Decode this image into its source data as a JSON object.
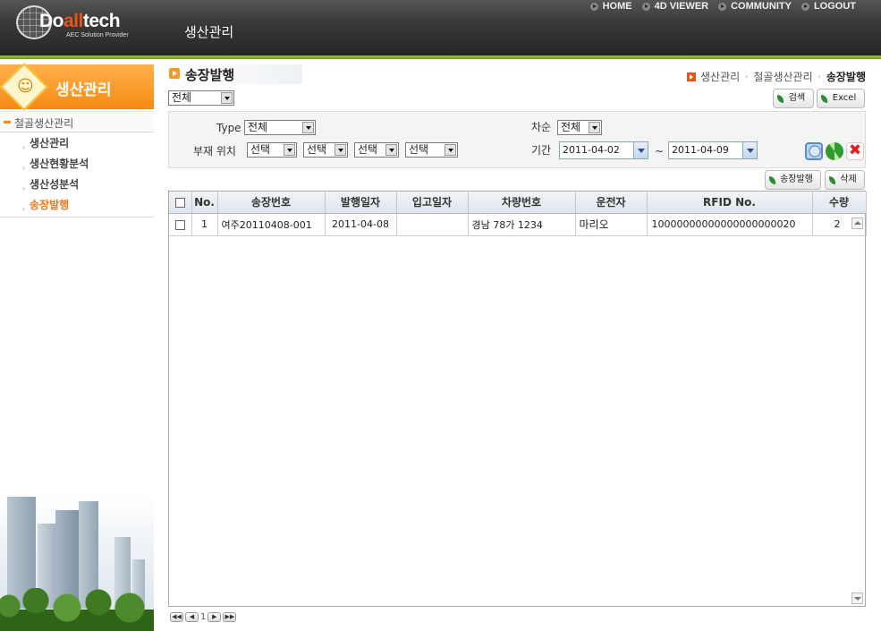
{
  "header": {
    "brand_pre": "Do",
    "brand_hl": "all",
    "brand_post": "tech",
    "tagline": "AEC Solution Provider",
    "title": "생산관리",
    "nav": [
      "HOME",
      "4D VIEWER",
      "COMMUNITY",
      "LOGOUT"
    ]
  },
  "sidebar": {
    "heading": "생산관리",
    "group": "철골생산관리",
    "items": [
      {
        "label": "생산관리",
        "active": false
      },
      {
        "label": "생산현황분석",
        "active": false
      },
      {
        "label": "생산성분석",
        "active": false
      },
      {
        "label": "송장발행",
        "active": true
      }
    ]
  },
  "page": {
    "title": "송장발행",
    "breadcrumb": [
      "생산관리",
      "철골생산관리",
      "송장발행"
    ],
    "scope_select": "전체",
    "buttons": {
      "search": "검색",
      "excel": "Excel",
      "issue": "송장발행",
      "delete": "삭제"
    }
  },
  "filters": {
    "type_label": "Type",
    "type_value": "전체",
    "position_label": "부재 위치",
    "position_values": [
      "선택",
      "선택",
      "선택",
      "선택"
    ],
    "round_label": "차순",
    "round_value": "전체",
    "period_label": "기간",
    "date_from": "2011-04-02",
    "tilde": "~",
    "date_to": "2011-04-09"
  },
  "grid": {
    "columns": [
      "",
      "No.",
      "송장번호",
      "발행일자",
      "입고일자",
      "차량번호",
      "운전자",
      "RFID No.",
      "수량"
    ],
    "rows": [
      {
        "no": "1",
        "invoice": "여주20110408-001",
        "issue_date": "2011-04-08",
        "in_date": "",
        "vehicle": "경남 78가 1234",
        "driver": "마리오",
        "rfid": "10000000000000000000020",
        "qty": "2"
      }
    ]
  },
  "pager": {
    "page": "1"
  },
  "colors": {
    "accent": "#f58a12",
    "active": "#e8781a",
    "header": "#2e2e2e",
    "green": "#7cad27"
  }
}
